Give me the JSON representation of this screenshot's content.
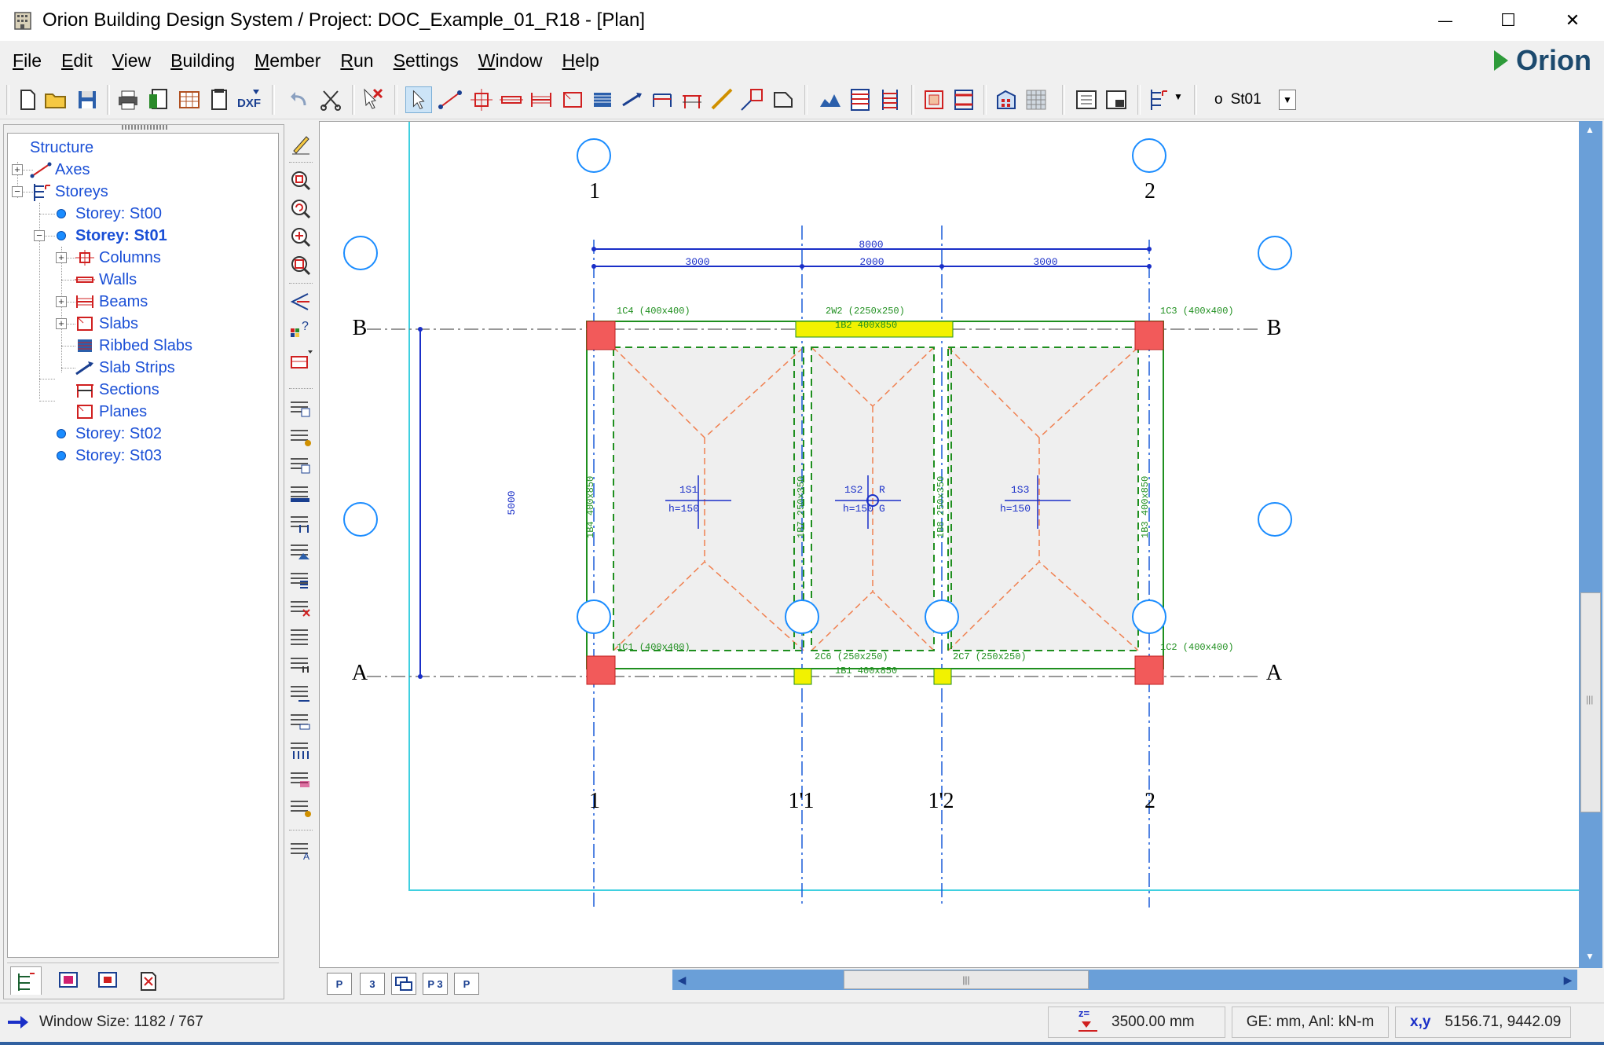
{
  "window": {
    "title": "Orion Building Design System / Project: DOC_Example_01_R18 - [Plan]",
    "minimize": "—",
    "maximize": "☐",
    "close": "✕"
  },
  "menu": {
    "items": [
      {
        "label": "File",
        "u": "F",
        "rest": "ile"
      },
      {
        "label": "Edit",
        "u": "E",
        "rest": "dit"
      },
      {
        "label": "View",
        "u": "V",
        "rest": "iew"
      },
      {
        "label": "Building",
        "u": "B",
        "rest": "uilding"
      },
      {
        "label": "Member",
        "u": "M",
        "rest": "ember"
      },
      {
        "label": "Run",
        "u": "R",
        "rest": "un"
      },
      {
        "label": "Settings",
        "u": "S",
        "rest": "ettings"
      },
      {
        "label": "Window",
        "u": "W",
        "rest": "indow"
      },
      {
        "label": "Help",
        "u": "H",
        "rest": "elp"
      }
    ]
  },
  "brand": {
    "name": "Orion",
    "color": "#1c4a6e",
    "arrow_color": "#2e9b3a"
  },
  "toolbar": {
    "storey_prefix": "o",
    "storey_value": "St01",
    "dropdown_glyph": "▼"
  },
  "tree": {
    "root": "Structure",
    "axes": "Axes",
    "storeys": "Storeys",
    "storey_st00": "Storey: St00",
    "storey_st01": "Storey: St01",
    "columns": "Columns",
    "walls": "Walls",
    "beams": "Beams",
    "slabs": "Slabs",
    "ribbed_slabs": "Ribbed Slabs",
    "slab_strips": "Slab Strips",
    "sections": "Sections",
    "planes": "Planes",
    "storey_st02": "Storey: St02",
    "storey_st03": "Storey: St03",
    "expand_plus": "+",
    "expand_minus": "−"
  },
  "plan": {
    "axes_top": [
      "1",
      "2"
    ],
    "axes_bottom": [
      "1",
      "1'1",
      "1'2",
      "2"
    ],
    "axes_left": [
      "B",
      "A"
    ],
    "axes_right": [
      "B",
      "A"
    ],
    "dim_total": "8000",
    "dim_spans": [
      "3000",
      "2000",
      "3000"
    ],
    "dim_vertical": "5000",
    "columns": {
      "c4": "1C4 (400x400)",
      "c3": "1C3 (400x400)",
      "c1": "1C1 (400x400)",
      "c2": "1C2 (400x400)",
      "w2": "2W2 (2250x250)",
      "c6": "2C6 (250x250)",
      "c7": "2C7 (250x250)"
    },
    "beams": {
      "b2": "1B2 400x850",
      "b1": "1B1 400x850",
      "b4": "1B4 400x850",
      "b7": "1B7 250x350",
      "b8": "1B8 250x350",
      "b3": "1B3 400x850"
    },
    "slabs": [
      {
        "name": "1S1",
        "h": "h=150"
      },
      {
        "name": "1S2",
        "h": "h=150"
      },
      {
        "name": "1S3",
        "h": "h=150"
      }
    ],
    "ref_r": "R",
    "ref_g": "G"
  },
  "sheet_tabs": [
    "P",
    "3",
    "",
    "P 3",
    "P"
  ],
  "hscroll_grip": "|||",
  "statusbar": {
    "window_size": "Window Size: 1182 / 767",
    "elevation": "3500.00 mm",
    "units": "GE: mm, Anl: kN-m",
    "xy_label": "x,y",
    "xy_value": "5156.71, 9442.09",
    "z_label": "z="
  },
  "colors": {
    "axis_blue": "#1a5cd8",
    "column_red": "#f25a5a",
    "beam_green": "#1f8f1f",
    "yellow_col": "#f2f200",
    "slab_fill": "#f0f0f0",
    "yield_orange": "#f08050",
    "frame_cyan": "#3fd0e0"
  }
}
